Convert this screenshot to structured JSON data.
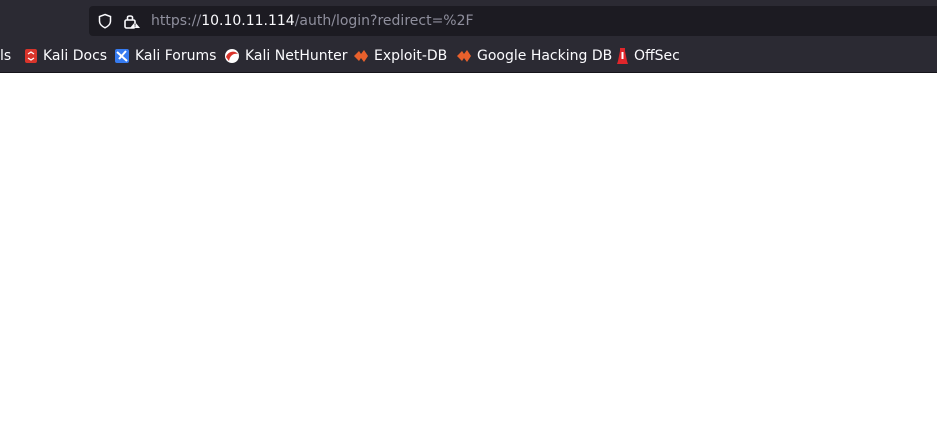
{
  "address_bar": {
    "scheme": "https://",
    "host": "10.10.11.114",
    "path": "/auth/login?redirect=%2F"
  },
  "bookmarks": {
    "partial_label": "ls",
    "items": [
      {
        "label": "Kali Docs",
        "icon": "kali-docs-icon"
      },
      {
        "label": "Kali Forums",
        "icon": "kali-forums-icon"
      },
      {
        "label": "Kali NetHunter",
        "icon": "kali-nethunter-icon"
      },
      {
        "label": "Exploit-DB",
        "icon": "exploit-db-icon"
      },
      {
        "label": "Google Hacking DB",
        "icon": "google-hacking-db-icon"
      },
      {
        "label": "OffSec",
        "icon": "offsec-icon"
      }
    ]
  },
  "colors": {
    "toolbar_bg": "#2b2a33",
    "urlbar_bg": "#1c1b22",
    "page_bg": "#ffffff"
  }
}
